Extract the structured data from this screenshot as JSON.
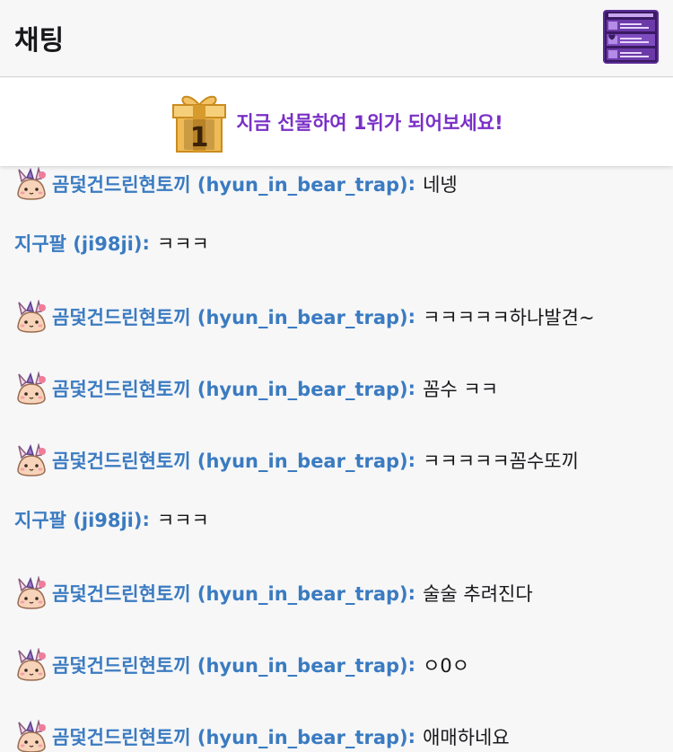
{
  "header": {
    "title": "채팅",
    "menu_icon": "chat-panel-icon"
  },
  "gift_banner": {
    "icon": "gift-box-icon",
    "rank": "1",
    "text": "지금 선물하여 1위가 되어보세요!"
  },
  "colors": {
    "username": "#3a7bc1",
    "gift_text": "#7a2fc6"
  },
  "messages": [
    {
      "badge": "bunny-badge-icon",
      "user": "곰덫건드린현토끼 (hyun_in_bear_trap)",
      "text": "네넹"
    },
    {
      "badge": "",
      "user": "지구팔 (ji98ji)",
      "text": "ㅋㅋㅋ"
    },
    {
      "badge": "bunny-badge-icon",
      "user": "곰덫건드린현토끼 (hyun_in_bear_trap)",
      "text": "ㅋㅋㅋㅋㅋ하나발견~"
    },
    {
      "badge": "bunny-badge-icon",
      "user": "곰덫건드린현토끼 (hyun_in_bear_trap)",
      "text": "꼼수 ㅋㅋ"
    },
    {
      "badge": "bunny-badge-icon",
      "user": "곰덫건드린현토끼 (hyun_in_bear_trap)",
      "text": "ㅋㅋㅋㅋㅋ꼼수또끼"
    },
    {
      "badge": "",
      "user": "지구팔 (ji98ji)",
      "text": "ㅋㅋㅋ"
    },
    {
      "badge": "bunny-badge-icon",
      "user": "곰덫건드린현토끼 (hyun_in_bear_trap)",
      "text": "술술 추려진다"
    },
    {
      "badge": "bunny-badge-icon",
      "user": "곰덫건드린현토끼 (hyun_in_bear_trap)",
      "text": "ㅇ0ㅇ"
    },
    {
      "badge": "bunny-badge-icon",
      "user": "곰덫건드린현토끼 (hyun_in_bear_trap)",
      "text": "애매하네요"
    }
  ]
}
